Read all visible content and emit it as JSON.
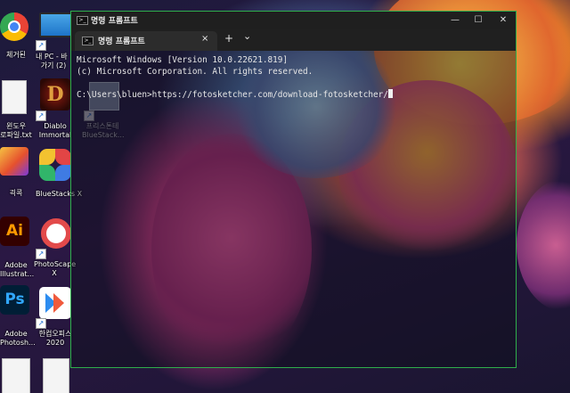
{
  "window": {
    "title": "명령 프롬프트",
    "tab_label": "명령 프롬프트",
    "tab_close": "×",
    "new_tab": "+",
    "dropdown": "⌄",
    "minimize": "—",
    "maximize": "☐",
    "close": "✕"
  },
  "console": {
    "line1": "Microsoft Windows [Version 10.0.22621.819]",
    "line2": "(c) Microsoft Corporation. All rights reserved.",
    "prompt": "C:\\Users\\bluen>",
    "command": "https://fotosketcher.com/download-fotosketcher/"
  },
  "desktop_icons": [
    {
      "name": "chrome",
      "label": "체거된"
    },
    {
      "name": "this-pc",
      "label": "내 PC - 바",
      "label2": "가기 (2)"
    },
    {
      "name": "word-doc",
      "label": "윈도우",
      "label2": "로파일.txt"
    },
    {
      "name": "diablo-immortal",
      "label": "Diablo",
      "label2": "Immortal"
    },
    {
      "name": "fotosketcher",
      "label": "프리스톤테",
      "label2": "BlueStack..."
    },
    {
      "name": "app-quick",
      "label": "괵콕"
    },
    {
      "name": "bluestacks-x",
      "label": "BlueStacks X"
    },
    {
      "name": "adobe-illustrator",
      "label": "Adobe",
      "label2": "Illustrat..."
    },
    {
      "name": "photoscape-x",
      "label": "PhotoScape",
      "label2": "X"
    },
    {
      "name": "adobe-photoshop",
      "label": "Adobe",
      "label2": "Photosh..."
    },
    {
      "name": "hancom-office",
      "label": "한컴오피스",
      "label2": "2020"
    }
  ]
}
